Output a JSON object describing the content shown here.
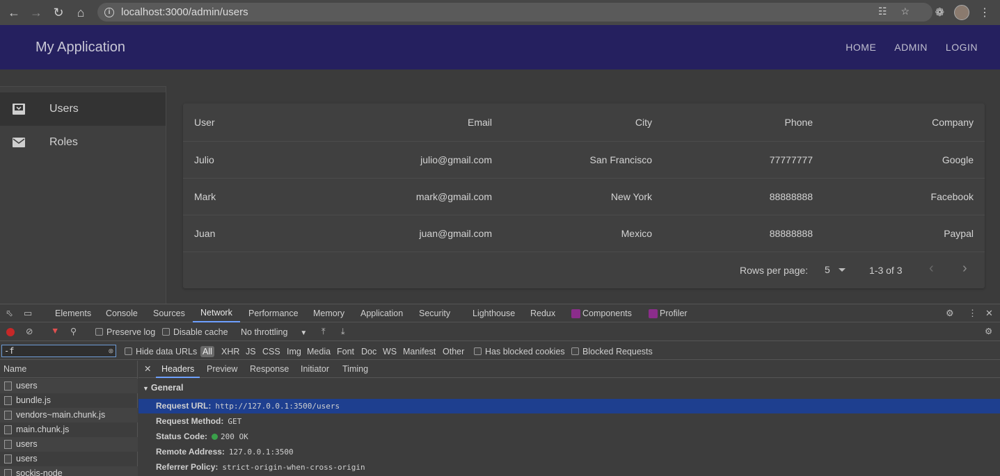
{
  "browser": {
    "url": "localhost:3000/admin/users"
  },
  "appbar": {
    "title": "My Application",
    "links": [
      "HOME",
      "ADMIN",
      "LOGIN"
    ]
  },
  "sidebar": {
    "items": [
      {
        "label": "Users",
        "icon": "inbox-icon",
        "active": true
      },
      {
        "label": "Roles",
        "icon": "mail-icon",
        "active": false
      }
    ]
  },
  "table": {
    "headers": [
      "User",
      "Email",
      "City",
      "Phone",
      "Company"
    ],
    "rows": [
      [
        "Julio",
        "julio@gmail.com",
        "San Francisco",
        "77777777",
        "Google"
      ],
      [
        "Mark",
        "mark@gmail.com",
        "New York",
        "88888888",
        "Facebook"
      ],
      [
        "Juan",
        "juan@gmail.com",
        "Mexico",
        "88888888",
        "Paypal"
      ]
    ],
    "pagination": {
      "rows_per_page_label": "Rows per page:",
      "rows_per_page": "5",
      "range": "1-3 of 3"
    }
  },
  "devtools": {
    "tabs": [
      "Elements",
      "Console",
      "Sources",
      "Network",
      "Performance",
      "Memory",
      "Application",
      "Security",
      "Lighthouse",
      "Redux",
      "Components",
      "Profiler"
    ],
    "active_tab": "Network",
    "toolbar": {
      "preserve_log": "Preserve log",
      "disable_cache": "Disable cache",
      "throttling": "No throttling"
    },
    "filter": {
      "value": "-f",
      "hide_data_urls": "Hide data URLs",
      "types": [
        "All",
        "XHR",
        "JS",
        "CSS",
        "Img",
        "Media",
        "Font",
        "Doc",
        "WS",
        "Manifest",
        "Other"
      ],
      "has_blocked_cookies": "Has blocked cookies",
      "blocked_requests": "Blocked Requests"
    },
    "name_header": "Name",
    "requests": [
      "users",
      "bundle.js",
      "vendors~main.chunk.js",
      "main.chunk.js",
      "users",
      "users",
      "sockjs-node"
    ],
    "detail_tabs": [
      "Headers",
      "Preview",
      "Response",
      "Initiator",
      "Timing"
    ],
    "general_label": "General",
    "general": [
      {
        "key": "Request URL:",
        "value": "http://127.0.0.1:3500/users"
      },
      {
        "key": "Request Method:",
        "value": "GET"
      },
      {
        "key": "Status Code:",
        "value": "200  OK"
      },
      {
        "key": "Remote Address:",
        "value": "127.0.0.1:3500"
      },
      {
        "key": "Referrer Policy:",
        "value": "strict-origin-when-cross-origin"
      }
    ]
  }
}
